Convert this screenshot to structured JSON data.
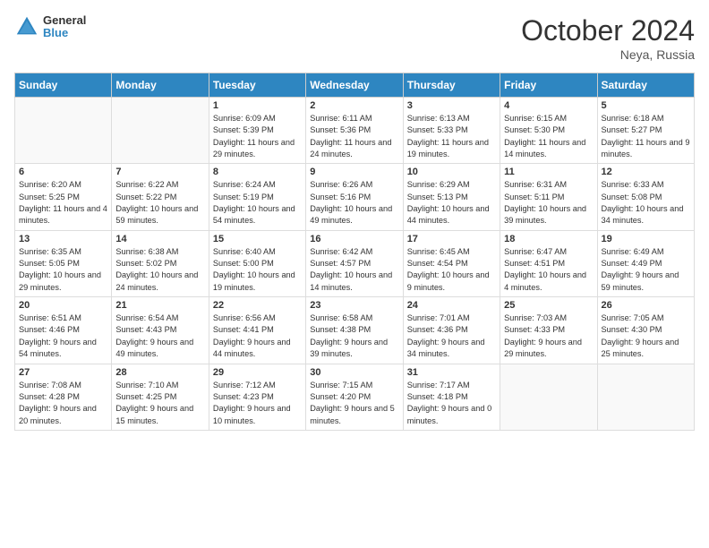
{
  "header": {
    "logo_line1": "General",
    "logo_line2": "Blue",
    "month_title": "October 2024",
    "location": "Neya, Russia"
  },
  "days_of_week": [
    "Sunday",
    "Monday",
    "Tuesday",
    "Wednesday",
    "Thursday",
    "Friday",
    "Saturday"
  ],
  "weeks": [
    [
      {
        "day": "",
        "info": ""
      },
      {
        "day": "",
        "info": ""
      },
      {
        "day": "1",
        "info": "Sunrise: 6:09 AM\nSunset: 5:39 PM\nDaylight: 11 hours and 29 minutes."
      },
      {
        "day": "2",
        "info": "Sunrise: 6:11 AM\nSunset: 5:36 PM\nDaylight: 11 hours and 24 minutes."
      },
      {
        "day": "3",
        "info": "Sunrise: 6:13 AM\nSunset: 5:33 PM\nDaylight: 11 hours and 19 minutes."
      },
      {
        "day": "4",
        "info": "Sunrise: 6:15 AM\nSunset: 5:30 PM\nDaylight: 11 hours and 14 minutes."
      },
      {
        "day": "5",
        "info": "Sunrise: 6:18 AM\nSunset: 5:27 PM\nDaylight: 11 hours and 9 minutes."
      }
    ],
    [
      {
        "day": "6",
        "info": "Sunrise: 6:20 AM\nSunset: 5:25 PM\nDaylight: 11 hours and 4 minutes."
      },
      {
        "day": "7",
        "info": "Sunrise: 6:22 AM\nSunset: 5:22 PM\nDaylight: 10 hours and 59 minutes."
      },
      {
        "day": "8",
        "info": "Sunrise: 6:24 AM\nSunset: 5:19 PM\nDaylight: 10 hours and 54 minutes."
      },
      {
        "day": "9",
        "info": "Sunrise: 6:26 AM\nSunset: 5:16 PM\nDaylight: 10 hours and 49 minutes."
      },
      {
        "day": "10",
        "info": "Sunrise: 6:29 AM\nSunset: 5:13 PM\nDaylight: 10 hours and 44 minutes."
      },
      {
        "day": "11",
        "info": "Sunrise: 6:31 AM\nSunset: 5:11 PM\nDaylight: 10 hours and 39 minutes."
      },
      {
        "day": "12",
        "info": "Sunrise: 6:33 AM\nSunset: 5:08 PM\nDaylight: 10 hours and 34 minutes."
      }
    ],
    [
      {
        "day": "13",
        "info": "Sunrise: 6:35 AM\nSunset: 5:05 PM\nDaylight: 10 hours and 29 minutes."
      },
      {
        "day": "14",
        "info": "Sunrise: 6:38 AM\nSunset: 5:02 PM\nDaylight: 10 hours and 24 minutes."
      },
      {
        "day": "15",
        "info": "Sunrise: 6:40 AM\nSunset: 5:00 PM\nDaylight: 10 hours and 19 minutes."
      },
      {
        "day": "16",
        "info": "Sunrise: 6:42 AM\nSunset: 4:57 PM\nDaylight: 10 hours and 14 minutes."
      },
      {
        "day": "17",
        "info": "Sunrise: 6:45 AM\nSunset: 4:54 PM\nDaylight: 10 hours and 9 minutes."
      },
      {
        "day": "18",
        "info": "Sunrise: 6:47 AM\nSunset: 4:51 PM\nDaylight: 10 hours and 4 minutes."
      },
      {
        "day": "19",
        "info": "Sunrise: 6:49 AM\nSunset: 4:49 PM\nDaylight: 9 hours and 59 minutes."
      }
    ],
    [
      {
        "day": "20",
        "info": "Sunrise: 6:51 AM\nSunset: 4:46 PM\nDaylight: 9 hours and 54 minutes."
      },
      {
        "day": "21",
        "info": "Sunrise: 6:54 AM\nSunset: 4:43 PM\nDaylight: 9 hours and 49 minutes."
      },
      {
        "day": "22",
        "info": "Sunrise: 6:56 AM\nSunset: 4:41 PM\nDaylight: 9 hours and 44 minutes."
      },
      {
        "day": "23",
        "info": "Sunrise: 6:58 AM\nSunset: 4:38 PM\nDaylight: 9 hours and 39 minutes."
      },
      {
        "day": "24",
        "info": "Sunrise: 7:01 AM\nSunset: 4:36 PM\nDaylight: 9 hours and 34 minutes."
      },
      {
        "day": "25",
        "info": "Sunrise: 7:03 AM\nSunset: 4:33 PM\nDaylight: 9 hours and 29 minutes."
      },
      {
        "day": "26",
        "info": "Sunrise: 7:05 AM\nSunset: 4:30 PM\nDaylight: 9 hours and 25 minutes."
      }
    ],
    [
      {
        "day": "27",
        "info": "Sunrise: 7:08 AM\nSunset: 4:28 PM\nDaylight: 9 hours and 20 minutes."
      },
      {
        "day": "28",
        "info": "Sunrise: 7:10 AM\nSunset: 4:25 PM\nDaylight: 9 hours and 15 minutes."
      },
      {
        "day": "29",
        "info": "Sunrise: 7:12 AM\nSunset: 4:23 PM\nDaylight: 9 hours and 10 minutes."
      },
      {
        "day": "30",
        "info": "Sunrise: 7:15 AM\nSunset: 4:20 PM\nDaylight: 9 hours and 5 minutes."
      },
      {
        "day": "31",
        "info": "Sunrise: 7:17 AM\nSunset: 4:18 PM\nDaylight: 9 hours and 0 minutes."
      },
      {
        "day": "",
        "info": ""
      },
      {
        "day": "",
        "info": ""
      }
    ]
  ]
}
